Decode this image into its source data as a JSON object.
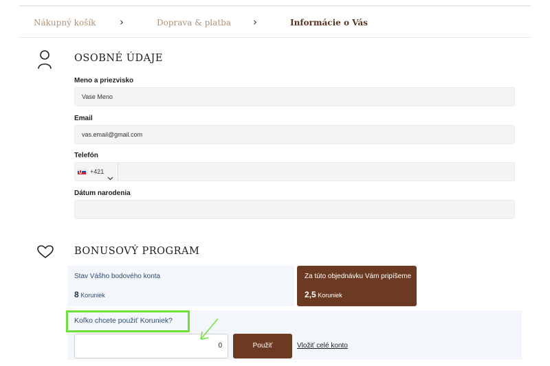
{
  "breadcrumb": {
    "steps": [
      "Nákupný košík",
      "Doprava & platba",
      "Informácie o Vás"
    ]
  },
  "personal": {
    "title": "OSOBNÉ ÚDAJE",
    "icon": "user-icon",
    "name_label": "Meno a priezvisko",
    "name_value": "Vase Meno",
    "email_label": "Email",
    "email_value": "vas.email@gmail.com",
    "phone_label": "Telefón",
    "phone_prefix": "+421",
    "phone_value": "",
    "birth_label": "Dátum narodenia",
    "birth_value": ""
  },
  "bonus": {
    "title": "BONUSOVÝ PROGRAM",
    "icon": "heart-icon",
    "balance_label": "Stav Vášho bodového konta",
    "balance_value": "8",
    "balance_unit": "Koruniek",
    "earn_label": "Za túto objednávku Vám pripíšeme",
    "earn_value": "2,5",
    "earn_unit": "Koruniek",
    "question": "Koľko chcete použiť Koruniek?",
    "input_value": "0",
    "apply_label": "Použiť",
    "use_all_label": "Vložiť celé konto"
  },
  "colors": {
    "brand_brown": "#6c3a22",
    "highlight_green": "#6ee03a",
    "link_blue": "#2d4b74"
  }
}
